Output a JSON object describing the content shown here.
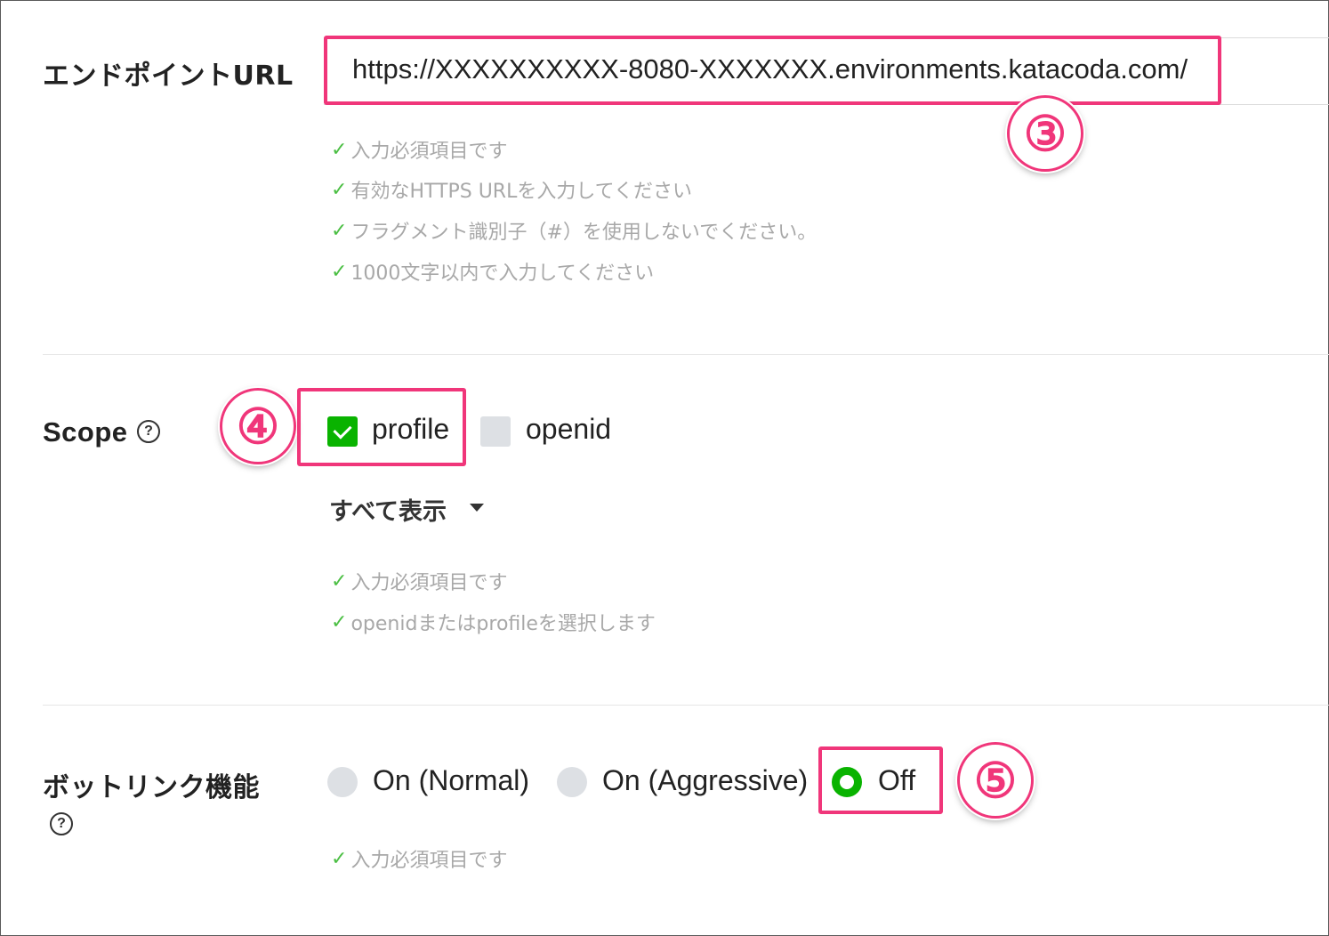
{
  "endpoint": {
    "label": "エンドポイントURL",
    "value": "https://XXXXXXXXXX-8080-XXXXXXX.environments.katacoda.com/",
    "badge": "③",
    "messages": [
      "入力必須項目です",
      "有効なHTTPS URLを入力してください",
      "フラグメント識別子（#）を使用しないでください。",
      "1000文字以内で入力してください"
    ]
  },
  "scope": {
    "label": "Scope",
    "help": "?",
    "badge": "④",
    "options": [
      {
        "label": "profile",
        "checked": true
      },
      {
        "label": "openid",
        "checked": false
      }
    ],
    "show_all": "すべて表示",
    "messages": [
      "入力必須項目です",
      "openidまたはprofileを選択します"
    ]
  },
  "bot_link": {
    "label": "ボットリンク機能",
    "help": "?",
    "badge": "⑤",
    "options": [
      {
        "label": "On (Normal)",
        "selected": false
      },
      {
        "label": "On (Aggressive)",
        "selected": false
      },
      {
        "label": "Off",
        "selected": true
      }
    ],
    "messages": [
      "入力必須項目です"
    ]
  },
  "colors": {
    "accent_green": "#09b300",
    "highlight_pink": "#f0367a",
    "check_green": "#4cbf44"
  }
}
